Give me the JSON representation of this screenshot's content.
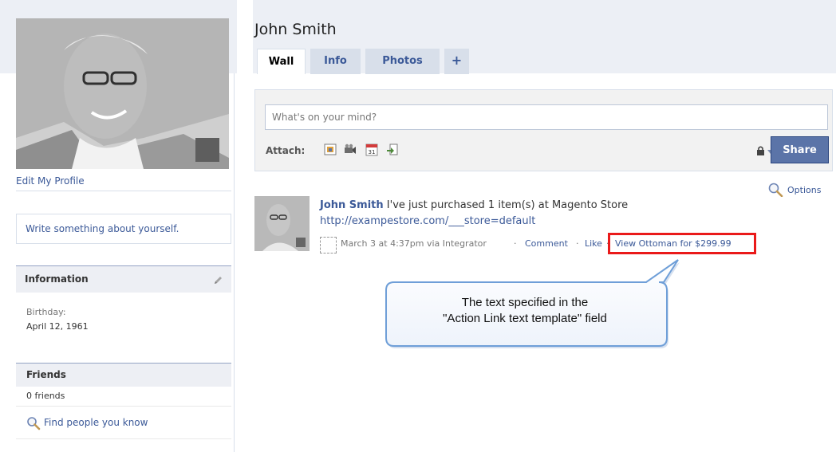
{
  "profile": {
    "name": "John Smith",
    "edit_profile": "Edit My Profile",
    "about_placeholder": "Write something about yourself."
  },
  "tabs": [
    {
      "label": "Wall",
      "active": true
    },
    {
      "label": "Info",
      "active": false
    },
    {
      "label": "Photos",
      "active": false
    },
    {
      "label": "+",
      "active": false
    }
  ],
  "composer": {
    "placeholder": "What's on your mind?",
    "attach_label": "Attach:",
    "attach_icons": [
      "photo-icon",
      "video-icon",
      "event-icon",
      "link-icon"
    ],
    "privacy_icon": "lock-icon",
    "share_label": "Share"
  },
  "sidebar": {
    "information": {
      "title": "Information",
      "edit_icon": "pencil-icon",
      "birthday_label": "Birthday:",
      "birthday_value": "April 12, 1961"
    },
    "friends": {
      "title": "Friends",
      "count": "0 friends",
      "find_people": "Find people you know"
    }
  },
  "feed": {
    "options_label": "Options",
    "story": {
      "author": "John Smith",
      "text": "I've just purchased 1 item(s) at Magento Store",
      "link": "http://exampestore.com/___store=default",
      "timestamp": "March 3 at 4:37pm via Integrator",
      "separator": "·",
      "comment": "Comment",
      "like": "Like",
      "action_link": "View Ottoman for $299.99"
    }
  },
  "callout": {
    "line1": "The text specified in the",
    "line2": "\"Action Link text template\" field"
  },
  "colors": {
    "link": "#3b5998",
    "highlight": "#ea1a1a",
    "share_button": "#5b74a8",
    "callout_border": "#6f9fd8"
  }
}
